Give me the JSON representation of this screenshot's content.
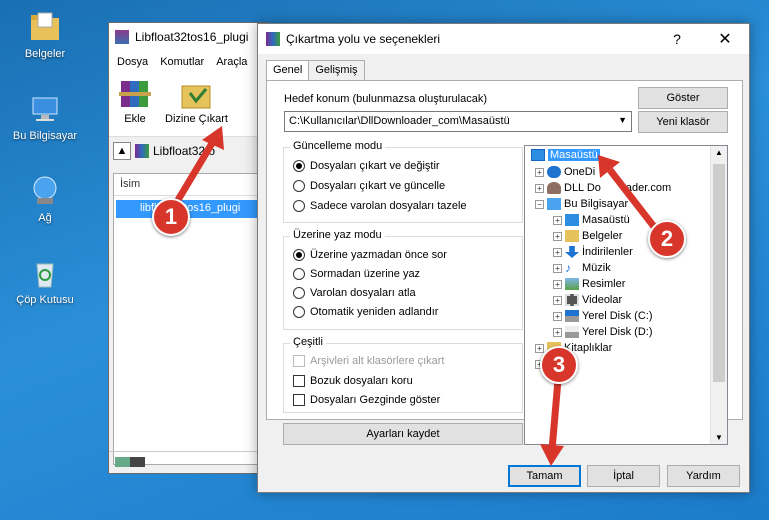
{
  "desktop": {
    "icons": [
      "Belgeler",
      "Bu Bilgisayar",
      "Ağ",
      "Çöp Kutusu"
    ]
  },
  "winrar": {
    "title": "Libfloat32tos16_plugi",
    "menu": [
      "Dosya",
      "Komutlar",
      "Araçla"
    ],
    "tools": [
      "Ekle",
      "Dizine Çıkart"
    ],
    "address": "Libfloat32to",
    "column_header": "İsim",
    "file": "libfloat32tos16_plugi"
  },
  "dialog": {
    "title": "Çıkartma yolu ve seçenekleri",
    "help": "?",
    "close": "✕",
    "tabs": [
      "Genel",
      "Gelişmiş"
    ],
    "dest_label": "Hedef konum (bulunmazsa oluşturulacak)",
    "dest_value": "C:\\Kullanıcılar\\DllDownloader_com\\Masaüstü",
    "show_btn": "Göster",
    "newfolder_btn": "Yeni klasör",
    "update_group": {
      "title": "Güncelleme modu",
      "options": [
        "Dosyaları çıkart ve değiştir",
        "Dosyaları çıkart ve güncelle",
        "Sadece varolan dosyaları tazele"
      ]
    },
    "overwrite_group": {
      "title": "Üzerine yaz modu",
      "options": [
        "Üzerine yazmadan önce sor",
        "Sormadan üzerine yaz",
        "Varolan dosyaları atla",
        "Otomatik yeniden adlandır"
      ]
    },
    "misc_group": {
      "title": "Çeşitli",
      "options": [
        "Arşivleri alt klasörlere çıkart",
        "Bozuk dosyaları koru",
        "Dosyaları Gezginde göster"
      ]
    },
    "save_btn": "Ayarları kaydet",
    "tree": [
      "Masaüstü",
      "OneDi",
      "DLL Do",
      "ader.com",
      "Bu Bilgisayar",
      "Masaüstü",
      "Belgeler",
      "İndirilenler",
      "Müzik",
      "Resimler",
      "Videolar",
      "Yerel Disk (C:)",
      "Yerel Disk (D:)",
      "Kitaplıklar",
      "a"
    ],
    "ok_btn": "Tamam",
    "cancel_btn": "İptal",
    "help_btn": "Yardım"
  },
  "callouts": [
    "1",
    "2",
    "3"
  ],
  "colors": {
    "callout": "#d9362b",
    "selection": "#3399ff",
    "accent": "#0078d7"
  }
}
